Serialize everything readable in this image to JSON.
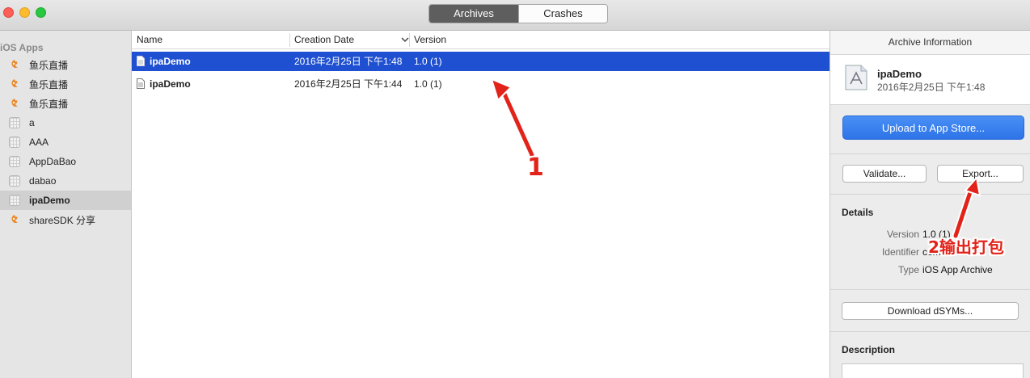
{
  "window": {
    "tabs": [
      {
        "label": "Archives",
        "active": true
      },
      {
        "label": "Crashes",
        "active": false
      }
    ]
  },
  "sidebar": {
    "header": "iOS Apps",
    "items": [
      {
        "label": "鱼乐直播",
        "icon": "fish-app-icon",
        "selected": false
      },
      {
        "label": "鱼乐直播",
        "icon": "fish-app-icon",
        "selected": false
      },
      {
        "label": "鱼乐直播",
        "icon": "fish-app-icon",
        "selected": false
      },
      {
        "label": "a",
        "icon": "generic-app-icon",
        "selected": false
      },
      {
        "label": "AAA",
        "icon": "generic-app-icon",
        "selected": false
      },
      {
        "label": "AppDaBao",
        "icon": "generic-app-icon",
        "selected": false
      },
      {
        "label": "dabao",
        "icon": "generic-app-icon",
        "selected": false
      },
      {
        "label": "ipaDemo",
        "icon": "generic-app-icon",
        "selected": true
      },
      {
        "label": "shareSDK 分享",
        "icon": "fish-app-icon",
        "selected": false
      }
    ]
  },
  "archive_list": {
    "columns": {
      "name": "Name",
      "creation_date": "Creation Date",
      "version": "Version"
    },
    "rows": [
      {
        "name": "ipaDemo",
        "date": "2016年2月25日 下午1:48",
        "version": "1.0 (1)",
        "selected": true
      },
      {
        "name": "ipaDemo",
        "date": "2016年2月25日 下午1:44",
        "version": "1.0 (1)",
        "selected": false
      }
    ]
  },
  "annotations": {
    "label_1": "1",
    "label_2": "2输出打包",
    "color": "#e2231a"
  },
  "inspector": {
    "title": "Archive Information",
    "archive_name": "ipaDemo",
    "archive_date": "2016年2月25日 下午1:48",
    "upload_button": "Upload to App Store...",
    "validate_button": "Validate...",
    "export_button": "Export...",
    "details_title": "Details",
    "details": {
      "version_label": "Version",
      "version_value": "1.0 (1)",
      "identifier_label": "Identifier",
      "identifier_value": "com.w...e...",
      "type_label": "Type",
      "type_value": "iOS App Archive"
    },
    "download_dsyms_button": "Download dSYMs...",
    "description_title": "Description"
  },
  "colors": {
    "selection": "#1f50d1",
    "primary_button": "#2d74e8"
  }
}
